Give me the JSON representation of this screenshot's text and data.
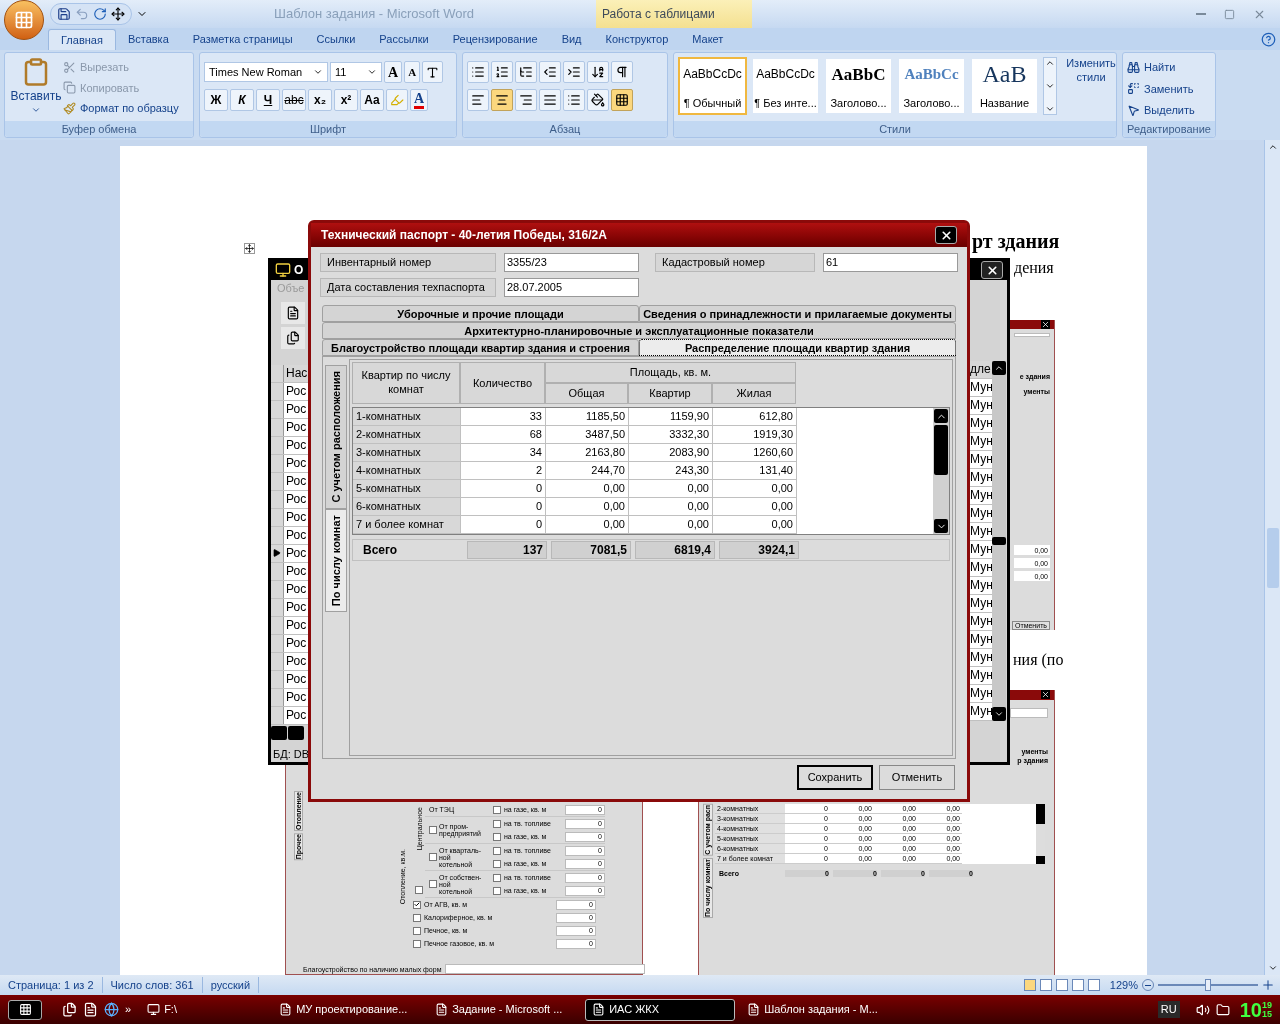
{
  "window": {
    "title": "Шаблон задания - Microsoft Word",
    "contextual_group": "Работа с таблицами"
  },
  "ribbon_tabs": [
    {
      "label": "Главная",
      "selected": true
    },
    {
      "label": "Вставка",
      "selected": false
    },
    {
      "label": "Разметка страницы",
      "selected": false
    },
    {
      "label": "Ссылки",
      "selected": false
    },
    {
      "label": "Рассылки",
      "selected": false
    },
    {
      "label": "Рецензирование",
      "selected": false
    },
    {
      "label": "Вид",
      "selected": false
    },
    {
      "label": "Конструктор",
      "selected": false
    },
    {
      "label": "Макет",
      "selected": false
    }
  ],
  "clipboard": {
    "paste": "Вставить",
    "cut": "Вырезать",
    "copy": "Копировать",
    "format_painter": "Формат по образцу",
    "group": "Буфер обмена"
  },
  "font": {
    "name": "Times New Roman",
    "size": "11",
    "grow": "A",
    "shrink": "A",
    "format_buttons": [
      "Ж",
      "К",
      "Ч",
      "abc",
      "x₂",
      "x²",
      "Aa"
    ],
    "color_button": "A",
    "group": "Шрифт"
  },
  "paragraph": {
    "show_marks_on": false,
    "alignments": [
      {
        "kind": "left",
        "selected": false
      },
      {
        "kind": "center",
        "selected": true
      },
      {
        "kind": "right",
        "selected": false
      },
      {
        "kind": "justify",
        "selected": false
      }
    ],
    "group": "Абзац"
  },
  "styles": {
    "items": [
      {
        "preview": "AaBbCcDc",
        "label": "¶ Обычный",
        "kind": "normal",
        "selected": true
      },
      {
        "preview": "AaBbCcDc",
        "label": "¶ Без инте...",
        "kind": "normal",
        "selected": false
      },
      {
        "preview": "AaBbC",
        "label": "Заголово...",
        "kind": "heading1",
        "selected": false
      },
      {
        "preview": "AaBbCc",
        "label": "Заголово...",
        "kind": "heading2",
        "selected": false
      },
      {
        "preview": "AaB",
        "label": "Название",
        "kind": "title",
        "selected": false
      }
    ],
    "change": "Изменить стили",
    "group": "Стили"
  },
  "editing": {
    "find": "Найти",
    "replace": "Заменить",
    "select": "Выделить",
    "group": "Редактирование"
  },
  "document": {
    "heading_fragment": "рт здания",
    "line_fragment": "дения",
    "caption_fragment": "ния (по"
  },
  "app_window": {
    "title": "О",
    "menu": "Объе",
    "left_header": "Нас",
    "right_header": "дле",
    "status": "БД: DB",
    "rows": [
      {
        "left": "Рос",
        "right": "Мун",
        "selected": false
      },
      {
        "left": "Рос",
        "right": "Мун",
        "selected": false
      },
      {
        "left": "Рос",
        "right": "Мун",
        "selected": false
      },
      {
        "left": "Рос",
        "right": "Мун",
        "selected": false
      },
      {
        "left": "Рос",
        "right": "Мун",
        "selected": false
      },
      {
        "left": "Рос",
        "right": "Мун",
        "selected": false
      },
      {
        "left": "Рос",
        "right": "Мун",
        "selected": false
      },
      {
        "left": "Рос",
        "right": "Мун",
        "selected": false
      },
      {
        "left": "Рос",
        "right": "Мун",
        "selected": false
      },
      {
        "left": "Рос",
        "right": "Мун",
        "selected": true
      },
      {
        "left": "Рос",
        "right": "Мун",
        "selected": false
      },
      {
        "left": "Рос",
        "right": "Мун",
        "selected": false
      },
      {
        "left": "Рос",
        "right": "Мун",
        "selected": false
      },
      {
        "left": "Рос",
        "right": "Мун",
        "selected": false
      },
      {
        "left": "Рос",
        "right": "Мун",
        "selected": false
      },
      {
        "left": "Рос",
        "right": "Мун",
        "selected": false
      },
      {
        "left": "Рос",
        "right": "Мун",
        "selected": false
      },
      {
        "left": "Рос",
        "right": "Мун",
        "selected": false
      },
      {
        "left": "Рос",
        "right": "Мун",
        "selected": false
      }
    ]
  },
  "dialog": {
    "title": "Технический паспорт - 40-летия Победы, 316/2А",
    "fields": [
      {
        "label": "Инвентарный номер",
        "value": "3355/23"
      },
      {
        "label": "Кадастровый номер",
        "value": "61"
      },
      {
        "label": "Дата составления техпаспорта",
        "value": "28.07.2005"
      }
    ],
    "tab_rows": [
      [
        {
          "label": "Уборочные и прочие площади",
          "selected": false
        },
        {
          "label": "Сведения о принадлежности и прилагаемые документы",
          "selected": false
        }
      ],
      [
        {
          "label": "Архитектурно-планировочные и эксплуатационные показатели",
          "selected": false
        }
      ],
      [
        {
          "label": "Благоустройство площади квартир здания и строения",
          "selected": false
        },
        {
          "label": "Распределение площади квартир здания",
          "selected": true
        }
      ]
    ],
    "side_tabs": [
      {
        "label": "С учетом расположения",
        "selected": false
      },
      {
        "label": "По числу комнат",
        "selected": true
      }
    ],
    "table": {
      "col_rooms": "Квартир по числу комнат",
      "col_count": "Количество",
      "area_group": "Площадь, кв. м.",
      "area_cols": [
        "Общая",
        "Квартир",
        "Жилая"
      ],
      "rows": [
        [
          "1-комнатных",
          "33",
          "1185,50",
          "1159,90",
          "612,80"
        ],
        [
          "2-комнатных",
          "68",
          "3487,50",
          "3332,30",
          "1919,30"
        ],
        [
          "3-комнатных",
          "34",
          "2163,80",
          "2083,90",
          "1260,60"
        ],
        [
          "4-комнатных",
          "2",
          "244,70",
          "243,30",
          "131,40"
        ],
        [
          "5-комнатных",
          "0",
          "0,00",
          "0,00",
          "0,00"
        ],
        [
          "6-комнатных",
          "0",
          "0,00",
          "0,00",
          "0,00"
        ],
        [
          "7 и более комнат",
          "0",
          "0,00",
          "0,00",
          "0,00"
        ]
      ],
      "total_label": "Всего",
      "totals": [
        "137",
        "7081,5",
        "6819,4",
        "3924,1"
      ]
    },
    "buttons": [
      {
        "label": "Сохранить",
        "kind": "default"
      },
      {
        "label": "Отменить",
        "kind": "normal"
      }
    ]
  },
  "embedded_mid": {
    "tab_a": "е здания",
    "tab_b": "ументы",
    "values": [
      "0,00",
      "0,00",
      "0,00"
    ],
    "button": "Отменить"
  },
  "embedded_right": {
    "tab_a": "ументы",
    "tab_b": "р здания",
    "side_tabs": [
      "С учетом расп",
      "По числу комнат"
    ],
    "rows": [
      [
        "2-комнатных",
        "0",
        "0,00",
        "0,00",
        "0,00"
      ],
      [
        "3-комнатных",
        "0",
        "0,00",
        "0,00",
        "0,00"
      ],
      [
        "4-комнатных",
        "0",
        "0,00",
        "0,00",
        "0,00"
      ],
      [
        "5-комнатных",
        "0",
        "0,00",
        "0,00",
        "0,00"
      ],
      [
        "6-комнатных",
        "0",
        "0,00",
        "0,00",
        "0,00"
      ],
      [
        "7 и более комнат",
        "0",
        "0,00",
        "0,00",
        "0,00"
      ]
    ],
    "total_label": "Всего",
    "totals": [
      "0",
      "0",
      "0",
      "0"
    ]
  },
  "embedded_left": {
    "side_tabs": [
      "Отопление",
      "Прочее"
    ],
    "heating_label": "Отопление, кв.м.",
    "central_label": "Центральное",
    "central_checked": false,
    "sources": [
      {
        "label": "От ТЭЦ",
        "items": [
          {
            "label": "на газе, кв. м",
            "checked": false,
            "value": "0"
          }
        ]
      },
      {
        "label": "От пром-предприятий",
        "checked": false,
        "items": [
          {
            "label": "на тв. топливе",
            "checked": false,
            "value": "0"
          },
          {
            "label": "на газе, кв. м",
            "checked": false,
            "value": "0"
          }
        ]
      },
      {
        "label": "От кварталь-ной котельной",
        "checked": false,
        "items": [
          {
            "label": "на тв. топливе",
            "checked": false,
            "value": "0"
          },
          {
            "label": "на газе, кв. м",
            "checked": false,
            "value": "0"
          }
        ]
      },
      {
        "label": "От собствен-ной котельной",
        "checked": false,
        "items": [
          {
            "label": "на тв. топливе",
            "checked": false,
            "value": "0"
          },
          {
            "label": "на газе, кв. м",
            "checked": false,
            "value": "0"
          }
        ]
      }
    ],
    "other": [
      {
        "label": "От АГВ, кв. м",
        "checked": true,
        "value": "0"
      },
      {
        "label": "Калориферное, кв. м",
        "checked": false,
        "value": "0"
      },
      {
        "label": "Печное, кв. м",
        "checked": false,
        "value": "0"
      },
      {
        "label": "Печное газовое, кв. м",
        "checked": false,
        "value": "0"
      }
    ],
    "footer_label": "Благоустройство по наличию малых форм"
  },
  "status_bar": {
    "page": "Страница: 1 из 2",
    "words": "Число слов: 361",
    "language": "русский",
    "zoom": "129%",
    "zoom_slider": {
      "level": 0.5
    }
  },
  "taskbar": {
    "more": "»",
    "drive": "F:\\",
    "items": [
      {
        "label": "МУ проектирование...",
        "selected": false
      },
      {
        "label": "Задание - Microsoft ...",
        "selected": false
      },
      {
        "label": "ИАС ЖКХ",
        "selected": true
      },
      {
        "label": "Шаблон задания - М...",
        "selected": false
      }
    ],
    "language": "RU",
    "clock_hour": "10",
    "clock_minute": "19",
    "clock_second": "15"
  }
}
